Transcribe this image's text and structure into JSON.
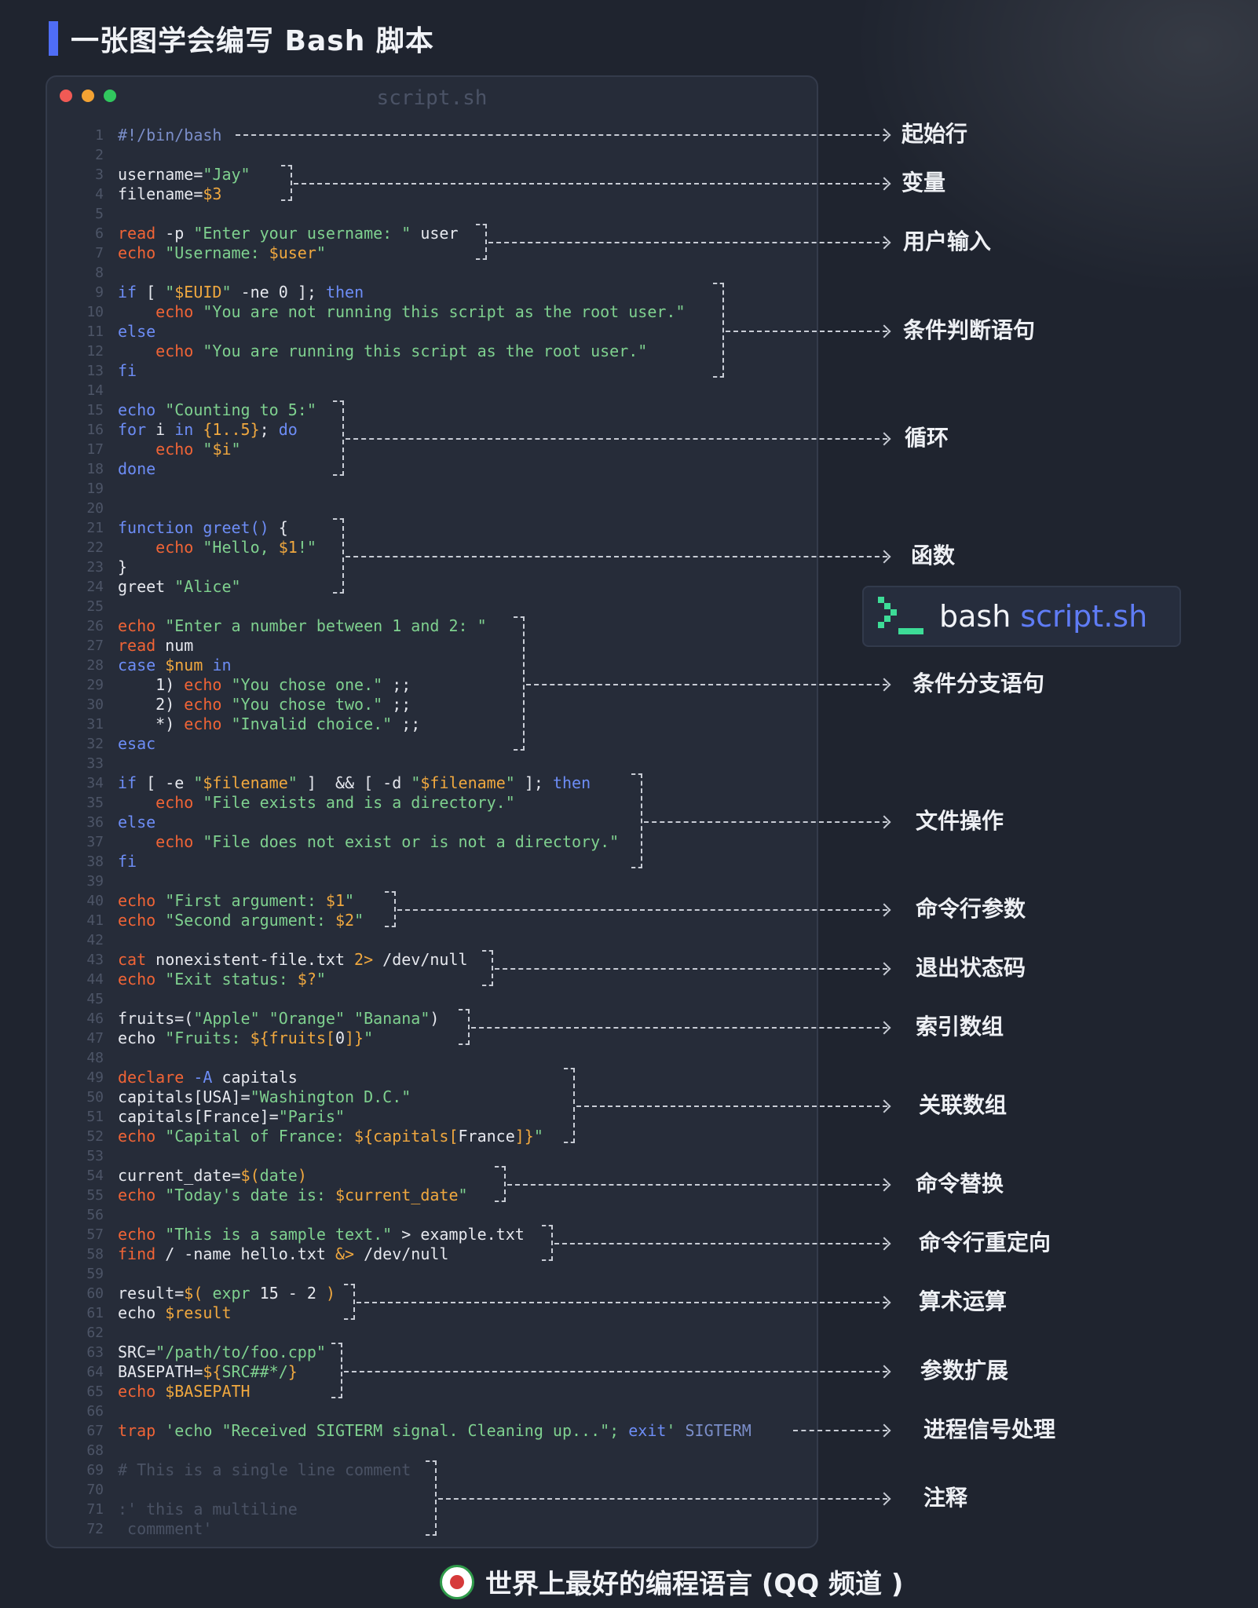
{
  "header": {
    "title": "一张图学会编写 Bash 脚本"
  },
  "window": {
    "title": "script.sh",
    "dots": [
      "#f15a55",
      "#f3a233",
      "#31c85e"
    ]
  },
  "code": [
    {
      "n": "1",
      "p": [
        [
          "sh",
          "#!/bin/bash"
        ]
      ]
    },
    {
      "n": "2",
      "p": []
    },
    {
      "n": "3",
      "p": [
        [
          "def",
          "username="
        ],
        [
          "str",
          "\"Jay\""
        ]
      ]
    },
    {
      "n": "4",
      "p": [
        [
          "def",
          "filename="
        ],
        [
          "var",
          "$3"
        ]
      ]
    },
    {
      "n": "5",
      "p": []
    },
    {
      "n": "6",
      "p": [
        [
          "kw",
          "read"
        ],
        [
          "def",
          " -p "
        ],
        [
          "str",
          "\"Enter your username: \""
        ],
        [
          "def",
          " user"
        ]
      ]
    },
    {
      "n": "7",
      "p": [
        [
          "kw",
          "echo"
        ],
        [
          "def",
          " "
        ],
        [
          "str",
          "\"Username: "
        ],
        [
          "var",
          "$user"
        ],
        [
          "str",
          "\""
        ]
      ]
    },
    {
      "n": "8",
      "p": []
    },
    {
      "n": "9",
      "p": [
        [
          "ctl",
          "if"
        ],
        [
          "def",
          " [ "
        ],
        [
          "str",
          "\""
        ],
        [
          "var",
          "$EUID"
        ],
        [
          "str",
          "\""
        ],
        [
          "def",
          " -ne 0 ]; "
        ],
        [
          "ctl",
          "then"
        ]
      ]
    },
    {
      "n": "10",
      "p": [
        [
          "def",
          "    "
        ],
        [
          "kw",
          "echo"
        ],
        [
          "def",
          " "
        ],
        [
          "str",
          "\"You are not running this script as the root user.\""
        ]
      ]
    },
    {
      "n": "11",
      "p": [
        [
          "ctl",
          "else"
        ]
      ]
    },
    {
      "n": "12",
      "p": [
        [
          "def",
          "    "
        ],
        [
          "kw",
          "echo"
        ],
        [
          "def",
          " "
        ],
        [
          "str",
          "\"You are running this script as the root user.\""
        ]
      ]
    },
    {
      "n": "13",
      "p": [
        [
          "ctl",
          "fi"
        ]
      ]
    },
    {
      "n": "14",
      "p": []
    },
    {
      "n": "15",
      "p": [
        [
          "ctl",
          "echo"
        ],
        [
          "def",
          " "
        ],
        [
          "str",
          "\"Counting to 5:\""
        ]
      ]
    },
    {
      "n": "16",
      "p": [
        [
          "ctl",
          "for"
        ],
        [
          "def",
          " i "
        ],
        [
          "ctl",
          "in"
        ],
        [
          "def",
          " "
        ],
        [
          "var",
          "{1..5}"
        ],
        [
          "def",
          "; "
        ],
        [
          "ctl",
          "do"
        ]
      ]
    },
    {
      "n": "17",
      "p": [
        [
          "def",
          "    "
        ],
        [
          "kw",
          "echo"
        ],
        [
          "def",
          " "
        ],
        [
          "str",
          "\""
        ],
        [
          "var",
          "$i"
        ],
        [
          "str",
          "\""
        ]
      ]
    },
    {
      "n": "18",
      "p": [
        [
          "ctl",
          "done"
        ]
      ]
    },
    {
      "n": "19",
      "p": []
    },
    {
      "n": "20",
      "p": []
    },
    {
      "n": "21",
      "p": [
        [
          "ctl",
          "function"
        ],
        [
          "def",
          " "
        ],
        [
          "ctl",
          "greet()"
        ],
        [
          "def",
          " {"
        ]
      ]
    },
    {
      "n": "22",
      "p": [
        [
          "def",
          "    "
        ],
        [
          "kw",
          "echo"
        ],
        [
          "def",
          " "
        ],
        [
          "str",
          "\"Hello, "
        ],
        [
          "var",
          "$1"
        ],
        [
          "str",
          "!\""
        ]
      ]
    },
    {
      "n": "23",
      "p": [
        [
          "def",
          "}"
        ]
      ]
    },
    {
      "n": "24",
      "p": [
        [
          "def",
          "greet "
        ],
        [
          "str",
          "\"Alice\""
        ]
      ]
    },
    {
      "n": "25",
      "p": []
    },
    {
      "n": "26",
      "p": [
        [
          "kw",
          "echo"
        ],
        [
          "def",
          " "
        ],
        [
          "str",
          "\"Enter a number between 1 and 2: \""
        ]
      ]
    },
    {
      "n": "27",
      "p": [
        [
          "kw",
          "read"
        ],
        [
          "def",
          " num"
        ]
      ]
    },
    {
      "n": "28",
      "p": [
        [
          "ctl",
          "case"
        ],
        [
          "def",
          " "
        ],
        [
          "var",
          "$num"
        ],
        [
          "def",
          " "
        ],
        [
          "ctl",
          "in"
        ]
      ]
    },
    {
      "n": "29",
      "p": [
        [
          "def",
          "    1) "
        ],
        [
          "kw",
          "echo"
        ],
        [
          "def",
          " "
        ],
        [
          "str",
          "\"You chose one.\""
        ],
        [
          "def",
          " ;;"
        ]
      ]
    },
    {
      "n": "30",
      "p": [
        [
          "def",
          "    2) "
        ],
        [
          "kw",
          "echo"
        ],
        [
          "def",
          " "
        ],
        [
          "str",
          "\"You chose two.\""
        ],
        [
          "def",
          " ;;"
        ]
      ]
    },
    {
      "n": "31",
      "p": [
        [
          "def",
          "    *) "
        ],
        [
          "kw",
          "echo"
        ],
        [
          "def",
          " "
        ],
        [
          "str",
          "\"Invalid choice.\""
        ],
        [
          "def",
          " ;;"
        ]
      ]
    },
    {
      "n": "32",
      "p": [
        [
          "ctl",
          "esac"
        ]
      ]
    },
    {
      "n": "33",
      "p": []
    },
    {
      "n": "34",
      "p": [
        [
          "ctl",
          "if"
        ],
        [
          "def",
          " [ -e "
        ],
        [
          "str",
          "\""
        ],
        [
          "var",
          "$filename"
        ],
        [
          "str",
          "\""
        ],
        [
          "def",
          " ]  && [ -d "
        ],
        [
          "str",
          "\""
        ],
        [
          "var",
          "$filename"
        ],
        [
          "str",
          "\""
        ],
        [
          "def",
          " ]; "
        ],
        [
          "ctl",
          "then"
        ]
      ]
    },
    {
      "n": "35",
      "p": [
        [
          "def",
          "    "
        ],
        [
          "kw",
          "echo"
        ],
        [
          "def",
          " "
        ],
        [
          "str",
          "\"File exists and is a directory.\""
        ]
      ]
    },
    {
      "n": "36",
      "p": [
        [
          "ctl",
          "else"
        ]
      ]
    },
    {
      "n": "37",
      "p": [
        [
          "def",
          "    "
        ],
        [
          "kw",
          "echo"
        ],
        [
          "def",
          " "
        ],
        [
          "str",
          "\"File does not exist or is not a directory.\""
        ]
      ]
    },
    {
      "n": "38",
      "p": [
        [
          "ctl",
          "fi"
        ]
      ]
    },
    {
      "n": "39",
      "p": []
    },
    {
      "n": "40",
      "p": [
        [
          "kw",
          "echo"
        ],
        [
          "def",
          " "
        ],
        [
          "str",
          "\"First argument: "
        ],
        [
          "var",
          "$1"
        ],
        [
          "str",
          "\""
        ]
      ]
    },
    {
      "n": "41",
      "p": [
        [
          "kw",
          "echo"
        ],
        [
          "def",
          " "
        ],
        [
          "str",
          "\"Second argument: "
        ],
        [
          "var",
          "$2"
        ],
        [
          "str",
          "\""
        ]
      ]
    },
    {
      "n": "42",
      "p": []
    },
    {
      "n": "43",
      "p": [
        [
          "kw",
          "cat"
        ],
        [
          "def",
          " nonexistent-file.txt "
        ],
        [
          "var",
          "2>"
        ],
        [
          "def",
          " /dev/null"
        ]
      ]
    },
    {
      "n": "44",
      "p": [
        [
          "kw",
          "echo"
        ],
        [
          "def",
          " "
        ],
        [
          "str",
          "\"Exit status: "
        ],
        [
          "var",
          "$?"
        ],
        [
          "str",
          "\""
        ]
      ]
    },
    {
      "n": "45",
      "p": []
    },
    {
      "n": "46",
      "p": [
        [
          "def",
          "fruits=("
        ],
        [
          "str",
          "\"Apple\" \"Orange\" \"Banana\""
        ],
        [
          "def",
          ")"
        ]
      ]
    },
    {
      "n": "47",
      "p": [
        [
          "def",
          "echo "
        ],
        [
          "str",
          "\"Fruits: "
        ],
        [
          "var",
          "${fruits["
        ],
        [
          "def",
          "0"
        ],
        [
          "var",
          "]}"
        ],
        [
          "str",
          "\""
        ]
      ]
    },
    {
      "n": "48",
      "p": []
    },
    {
      "n": "49",
      "p": [
        [
          "kw",
          "declare"
        ],
        [
          "def",
          " "
        ],
        [
          "ctl",
          "-A"
        ],
        [
          "def",
          " capitals"
        ]
      ]
    },
    {
      "n": "50",
      "p": [
        [
          "def",
          "capitals[USA]="
        ],
        [
          "str",
          "\"Washington D.C.\""
        ]
      ]
    },
    {
      "n": "51",
      "p": [
        [
          "def",
          "capitals[France]="
        ],
        [
          "str",
          "\"Paris\""
        ]
      ]
    },
    {
      "n": "52",
      "p": [
        [
          "kw",
          "echo"
        ],
        [
          "def",
          " "
        ],
        [
          "str",
          "\"Capital of France: "
        ],
        [
          "var",
          "${capitals["
        ],
        [
          "def",
          "France"
        ],
        [
          "var",
          "]}"
        ],
        [
          "str",
          "\""
        ]
      ]
    },
    {
      "n": "53",
      "p": []
    },
    {
      "n": "54",
      "p": [
        [
          "def",
          "current_date="
        ],
        [
          "var",
          "$("
        ],
        [
          "str",
          "date"
        ],
        [
          "var",
          ")"
        ]
      ]
    },
    {
      "n": "55",
      "p": [
        [
          "kw",
          "echo"
        ],
        [
          "def",
          " "
        ],
        [
          "str",
          "\"Today's date is: "
        ],
        [
          "var",
          "$current_date"
        ],
        [
          "str",
          "\""
        ]
      ]
    },
    {
      "n": "56",
      "p": []
    },
    {
      "n": "57",
      "p": [
        [
          "kw",
          "echo"
        ],
        [
          "def",
          " "
        ],
        [
          "str",
          "\"This is a sample text.\""
        ],
        [
          "def",
          " > example.txt"
        ]
      ]
    },
    {
      "n": "58",
      "p": [
        [
          "kw",
          "find"
        ],
        [
          "def",
          " / -name hello.txt "
        ],
        [
          "var",
          "&>"
        ],
        [
          "def",
          " /dev/null"
        ]
      ]
    },
    {
      "n": "59",
      "p": []
    },
    {
      "n": "60",
      "p": [
        [
          "def",
          "result="
        ],
        [
          "var",
          "$("
        ],
        [
          "def",
          " "
        ],
        [
          "str",
          "expr"
        ],
        [
          "def",
          " 15 - 2 "
        ],
        [
          "var",
          ")"
        ]
      ]
    },
    {
      "n": "61",
      "p": [
        [
          "def",
          "echo "
        ],
        [
          "var",
          "$result"
        ]
      ]
    },
    {
      "n": "62",
      "p": []
    },
    {
      "n": "63",
      "p": [
        [
          "def",
          "SRC="
        ],
        [
          "str",
          "\"/path/to/foo.cpp\""
        ]
      ]
    },
    {
      "n": "64",
      "p": [
        [
          "def",
          "BASEPATH="
        ],
        [
          "var",
          "${"
        ],
        [
          "str",
          "SRC##*/"
        ],
        [
          "var",
          "}"
        ]
      ]
    },
    {
      "n": "65",
      "p": [
        [
          "kw",
          "echo"
        ],
        [
          "def",
          " "
        ],
        [
          "var",
          "$BASEPATH"
        ]
      ]
    },
    {
      "n": "66",
      "p": []
    },
    {
      "n": "67",
      "p": [
        [
          "kw",
          "trap"
        ],
        [
          "def",
          " "
        ],
        [
          "str",
          "'echo \"Received SIGTERM signal. Cleaning up...\"; "
        ],
        [
          "ctl",
          "exit"
        ],
        [
          "str",
          "'"
        ],
        [
          "def",
          " "
        ],
        [
          "sh",
          "SIGTERM"
        ]
      ]
    },
    {
      "n": "68",
      "p": []
    },
    {
      "n": "69",
      "p": [
        [
          "com",
          "# This is a single line comment"
        ]
      ]
    },
    {
      "n": "70",
      "p": []
    },
    {
      "n": "71",
      "p": [
        [
          "com",
          ":' this a multiline"
        ]
      ]
    },
    {
      "n": "72",
      "p": [
        [
          "com",
          " commment'"
        ]
      ]
    }
  ],
  "annotations": [
    {
      "label": "起始行"
    },
    {
      "label": "变量"
    },
    {
      "label": "用户输入"
    },
    {
      "label": "条件判断语句"
    },
    {
      "label": "循环"
    },
    {
      "label": "函数"
    },
    {
      "label": "条件分支语句"
    },
    {
      "label": "文件操作"
    },
    {
      "label": "命令行参数"
    },
    {
      "label": "退出状态码"
    },
    {
      "label": "索引数组"
    },
    {
      "label": "关联数组"
    },
    {
      "label": "命令替换"
    },
    {
      "label": "命令行重定向"
    },
    {
      "label": "算术运算"
    },
    {
      "label": "参数扩展"
    },
    {
      "label": "进程信号处理"
    },
    {
      "label": "注释"
    }
  ],
  "badge": {
    "cmd": "bash",
    "arg": "script.sh",
    "icon": "terminal-prompt-icon",
    "icon_color": "#3ddc97"
  },
  "footer": {
    "text": "世界上最好的编程语言 (QQ 频道 )",
    "icon": "channel-logo-icon"
  }
}
